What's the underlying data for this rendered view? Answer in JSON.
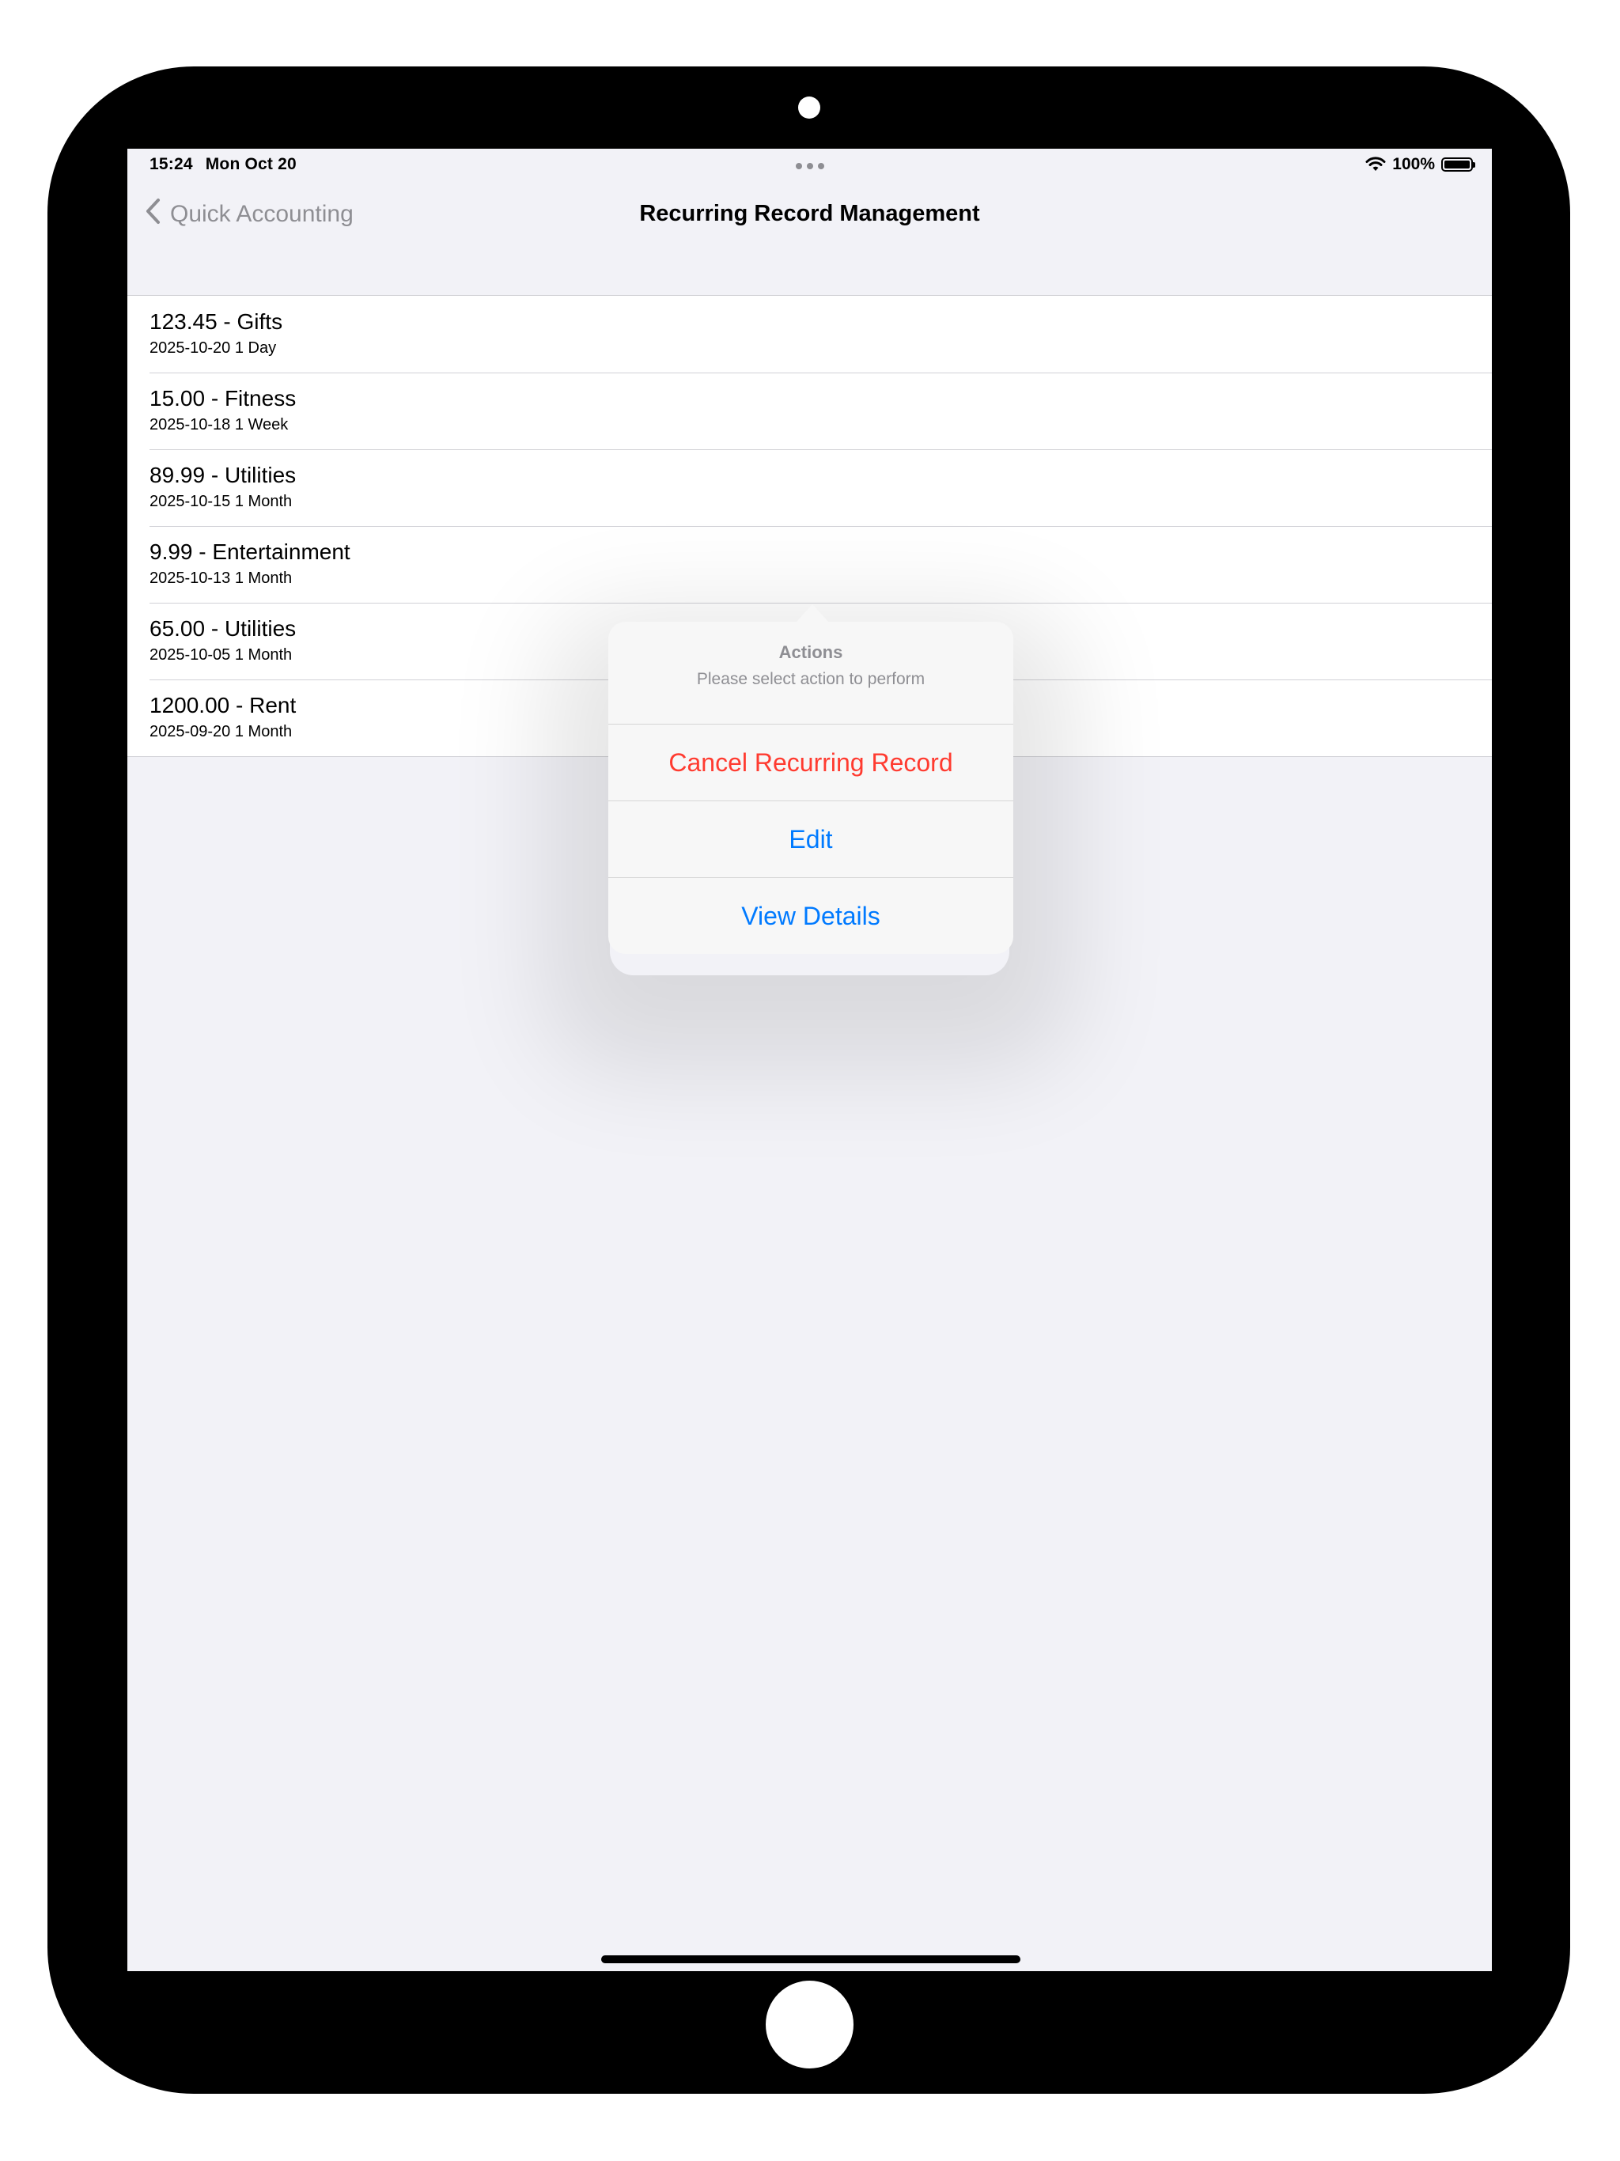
{
  "status_bar": {
    "time": "15:24",
    "date": "Mon Oct 20",
    "battery": "100%"
  },
  "nav": {
    "back_label": "Quick Accounting",
    "title": "Recurring Record Management"
  },
  "records": [
    {
      "title": "123.45 - Gifts",
      "subtitle": "2025-10-20 1 Day"
    },
    {
      "title": "15.00 - Fitness",
      "subtitle": "2025-10-18 1 Week"
    },
    {
      "title": "89.99 - Utilities",
      "subtitle": "2025-10-15 1 Month"
    },
    {
      "title": "9.99 - Entertainment",
      "subtitle": "2025-10-13 1 Month"
    },
    {
      "title": "65.00 - Utilities",
      "subtitle": "2025-10-05 1 Month"
    },
    {
      "title": "1200.00 - Rent",
      "subtitle": "2025-09-20 1 Month"
    }
  ],
  "popover": {
    "title": "Actions",
    "message": "Please select action to perform",
    "actions": [
      {
        "label": "Cancel Recurring Record",
        "style": "destructive"
      },
      {
        "label": "Edit",
        "style": "default"
      },
      {
        "label": "View Details",
        "style": "default"
      }
    ]
  },
  "colors": {
    "destructive": "#ff3b30",
    "accent": "#007aff",
    "background": "#f2f2f7"
  }
}
